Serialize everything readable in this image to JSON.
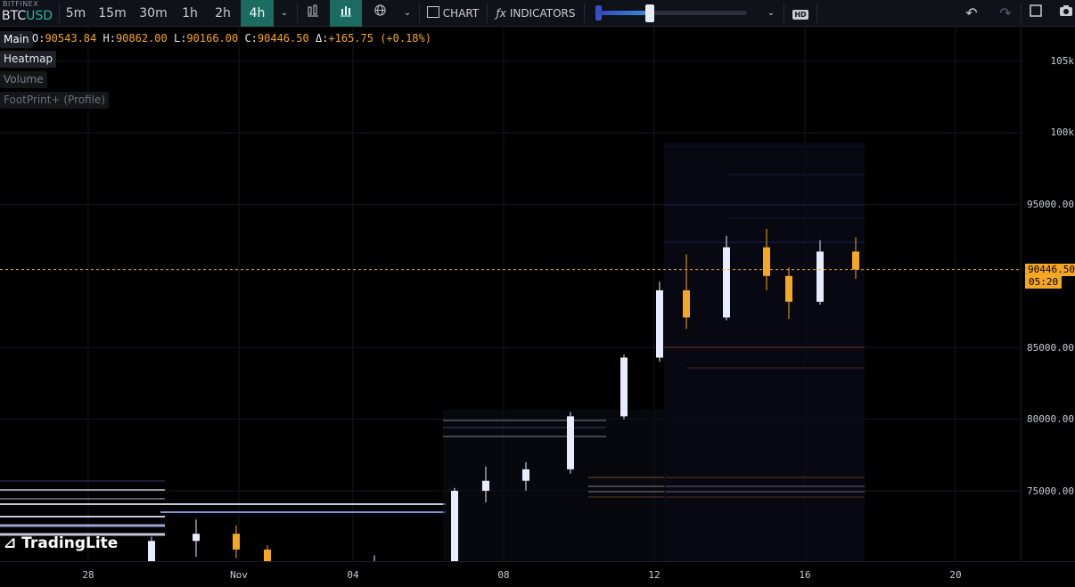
{
  "symbol": {
    "exchange": "BITFINEX",
    "base": "BTC",
    "quote": "USD"
  },
  "timeframes": [
    "5m",
    "15m",
    "30m",
    "1h",
    "2h",
    "4h"
  ],
  "active_timeframe": "4h",
  "toolbar": {
    "chart_label": "CHART",
    "indicators_label": "INDICATORS",
    "hd_label": "HD"
  },
  "legend": {
    "main_label": "Main",
    "o_label": "O:",
    "o": "90543.84",
    "h_label": "H:",
    "h": "90862.00",
    "l_label": "L:",
    "l": "90166.00",
    "c_label": "C:",
    "c": "90446.50",
    "d_label": "Δ:",
    "d": "+165.75 (+0.18%)"
  },
  "layers": [
    "Heatmap",
    "Volume",
    "FootPrint+ (Profile)"
  ],
  "price": {
    "last": "90446.50",
    "countdown": "05:20",
    "color": "#f5a623"
  },
  "y_axis_labels": [
    "105k",
    "100k",
    "95000.00",
    "85000.00",
    "80000.00",
    "75000.00"
  ],
  "x_axis_labels": [
    "28",
    "Nov",
    "04",
    "08",
    "12",
    "16",
    "20"
  ],
  "brand": "TradingLite",
  "colors": {
    "accent": "#1c6b61",
    "up": "#e8ecff",
    "down": "#f5a623",
    "bid_glow": "#4b5cff"
  },
  "chart_data": {
    "type": "candlestick-heatmap",
    "ylim": [
      70000,
      107000
    ],
    "x_categories": [
      "28",
      "Nov",
      "04",
      "08",
      "12",
      "16",
      "20"
    ],
    "candles": [
      {
        "o": 69200,
        "h": 71800,
        "l": 68800,
        "c": 71500,
        "x": "28"
      },
      {
        "o": 71500,
        "h": 73000,
        "l": 70400,
        "c": 72000,
        "x": "28"
      },
      {
        "o": 72000,
        "h": 72600,
        "l": 70300,
        "c": 70900,
        "x": "Nov"
      },
      {
        "o": 70900,
        "h": 71200,
        "l": 69300,
        "c": 69600,
        "x": "Nov"
      },
      {
        "o": 69600,
        "h": 70500,
        "l": 68900,
        "c": 70000,
        "x": "04"
      },
      {
        "o": 70000,
        "h": 75200,
        "l": 69800,
        "c": 75000,
        "x": "04"
      },
      {
        "o": 75000,
        "h": 76700,
        "l": 74200,
        "c": 75700,
        "x": "08"
      },
      {
        "o": 75700,
        "h": 77000,
        "l": 75000,
        "c": 76500,
        "x": "08"
      },
      {
        "o": 76500,
        "h": 80500,
        "l": 76200,
        "c": 80200,
        "x": "08"
      },
      {
        "o": 80200,
        "h": 84500,
        "l": 80000,
        "c": 84300,
        "x": "12"
      },
      {
        "o": 84300,
        "h": 89600,
        "l": 84000,
        "c": 89000,
        "x": "12"
      },
      {
        "o": 89000,
        "h": 91500,
        "l": 86300,
        "c": 87100,
        "x": "12"
      },
      {
        "o": 87100,
        "h": 92800,
        "l": 86900,
        "c": 92000,
        "x": "16"
      },
      {
        "o": 92000,
        "h": 93300,
        "l": 89000,
        "c": 90000,
        "x": "16"
      },
      {
        "o": 90000,
        "h": 90600,
        "l": 87000,
        "c": 88200,
        "x": "16"
      },
      {
        "o": 88200,
        "h": 92500,
        "l": 88000,
        "c": 91700,
        "x": "16"
      },
      {
        "o": 91700,
        "h": 92700,
        "l": 89800,
        "c": 90446.5,
        "x": "16"
      }
    ],
    "last_price_line": 90446.5
  }
}
